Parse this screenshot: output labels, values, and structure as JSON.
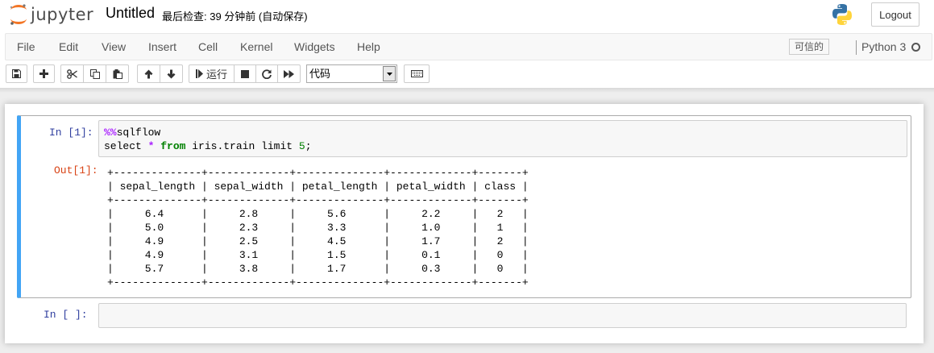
{
  "header": {
    "logo_text": "jupyter",
    "notebook_name": "Untitled",
    "save_status": "最后检查: 39 分钟前  (自动保存)",
    "logout_label": "Logout"
  },
  "menubar": {
    "items": [
      "File",
      "Edit",
      "View",
      "Insert",
      "Cell",
      "Kernel",
      "Widgets",
      "Help"
    ],
    "trusted_label": "可信的",
    "kernel_name": "Python 3"
  },
  "toolbar": {
    "run_label": "运行",
    "cell_type": "代码",
    "icons": [
      "save-icon",
      "plus-icon",
      "cut-icon",
      "copy-icon",
      "paste-icon",
      "arrow-up-icon",
      "arrow-down-icon",
      "step-forward-icon",
      "stop-icon",
      "restart-icon",
      "fast-forward-icon",
      "keyboard-icon"
    ]
  },
  "cells": [
    {
      "in_prompt": "In  [1]:",
      "code_line1_magic": "%%",
      "code_line1_rest": "sqlflow",
      "code_line2": [
        "select ",
        "*",
        " ",
        "from",
        " iris.train limit ",
        "5",
        ";"
      ],
      "out_prompt": "Out[1]:",
      "output": "+--------------+-------------+--------------+-------------+-------+\n| sepal_length | sepal_width | petal_length | petal_width | class |\n+--------------+-------------+--------------+-------------+-------+\n|     6.4      |     2.8     |     5.6      |     2.2     |   2   |\n|     5.0      |     2.3     |     3.3      |     1.0     |   1   |\n|     4.9      |     2.5     |     4.5      |     1.7     |   2   |\n|     4.9      |     3.1     |     1.5      |     0.1     |   0   |\n|     5.7      |     3.8     |     1.7      |     0.3     |   0   |\n+--------------+-------------+--------------+-------------+-------+"
    },
    {
      "in_prompt": "In  [ ]:",
      "code": ""
    }
  ],
  "colors": {
    "selected_cell_border": "#42a5f5",
    "in_prompt": "#303f9f",
    "out_prompt": "#d84315",
    "keyword": "#008000",
    "magic": "#aa22ff"
  }
}
